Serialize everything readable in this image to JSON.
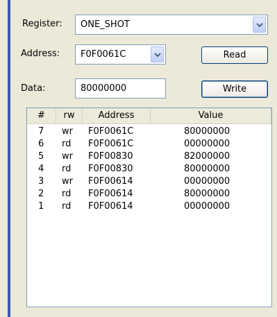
{
  "form": {
    "register_label": "Register:",
    "register_value": "ONE_SHOT",
    "address_label": "Address:",
    "address_value": "F0F0061C",
    "data_label": "Data:",
    "data_value": "80000000",
    "read_button": "Read",
    "write_button": "Write"
  },
  "log_table": {
    "columns": [
      "#",
      "rw",
      "Address",
      "Value"
    ],
    "rows": [
      {
        "num": "7",
        "rw": "wr",
        "address": "F0F0061C",
        "value": "80000000"
      },
      {
        "num": "6",
        "rw": "rd",
        "address": "F0F0061C",
        "value": "00000000"
      },
      {
        "num": "5",
        "rw": "wr",
        "address": "F0F00830",
        "value": "82000000"
      },
      {
        "num": "4",
        "rw": "rd",
        "address": "F0F00830",
        "value": "80000000"
      },
      {
        "num": "3",
        "rw": "wr",
        "address": "F0F00614",
        "value": "00000000"
      },
      {
        "num": "2",
        "rw": "rd",
        "address": "F0F00614",
        "value": "80000000"
      },
      {
        "num": "1",
        "rw": "rd",
        "address": "F0F00614",
        "value": "00000000"
      }
    ]
  },
  "icons": {
    "dropdown": "chevron-down-icon"
  },
  "colors": {
    "panel_bg": "#ece9d8",
    "accent_bar": "#3c57b0",
    "field_border": "#7f9db9",
    "button_border": "#003c74"
  }
}
